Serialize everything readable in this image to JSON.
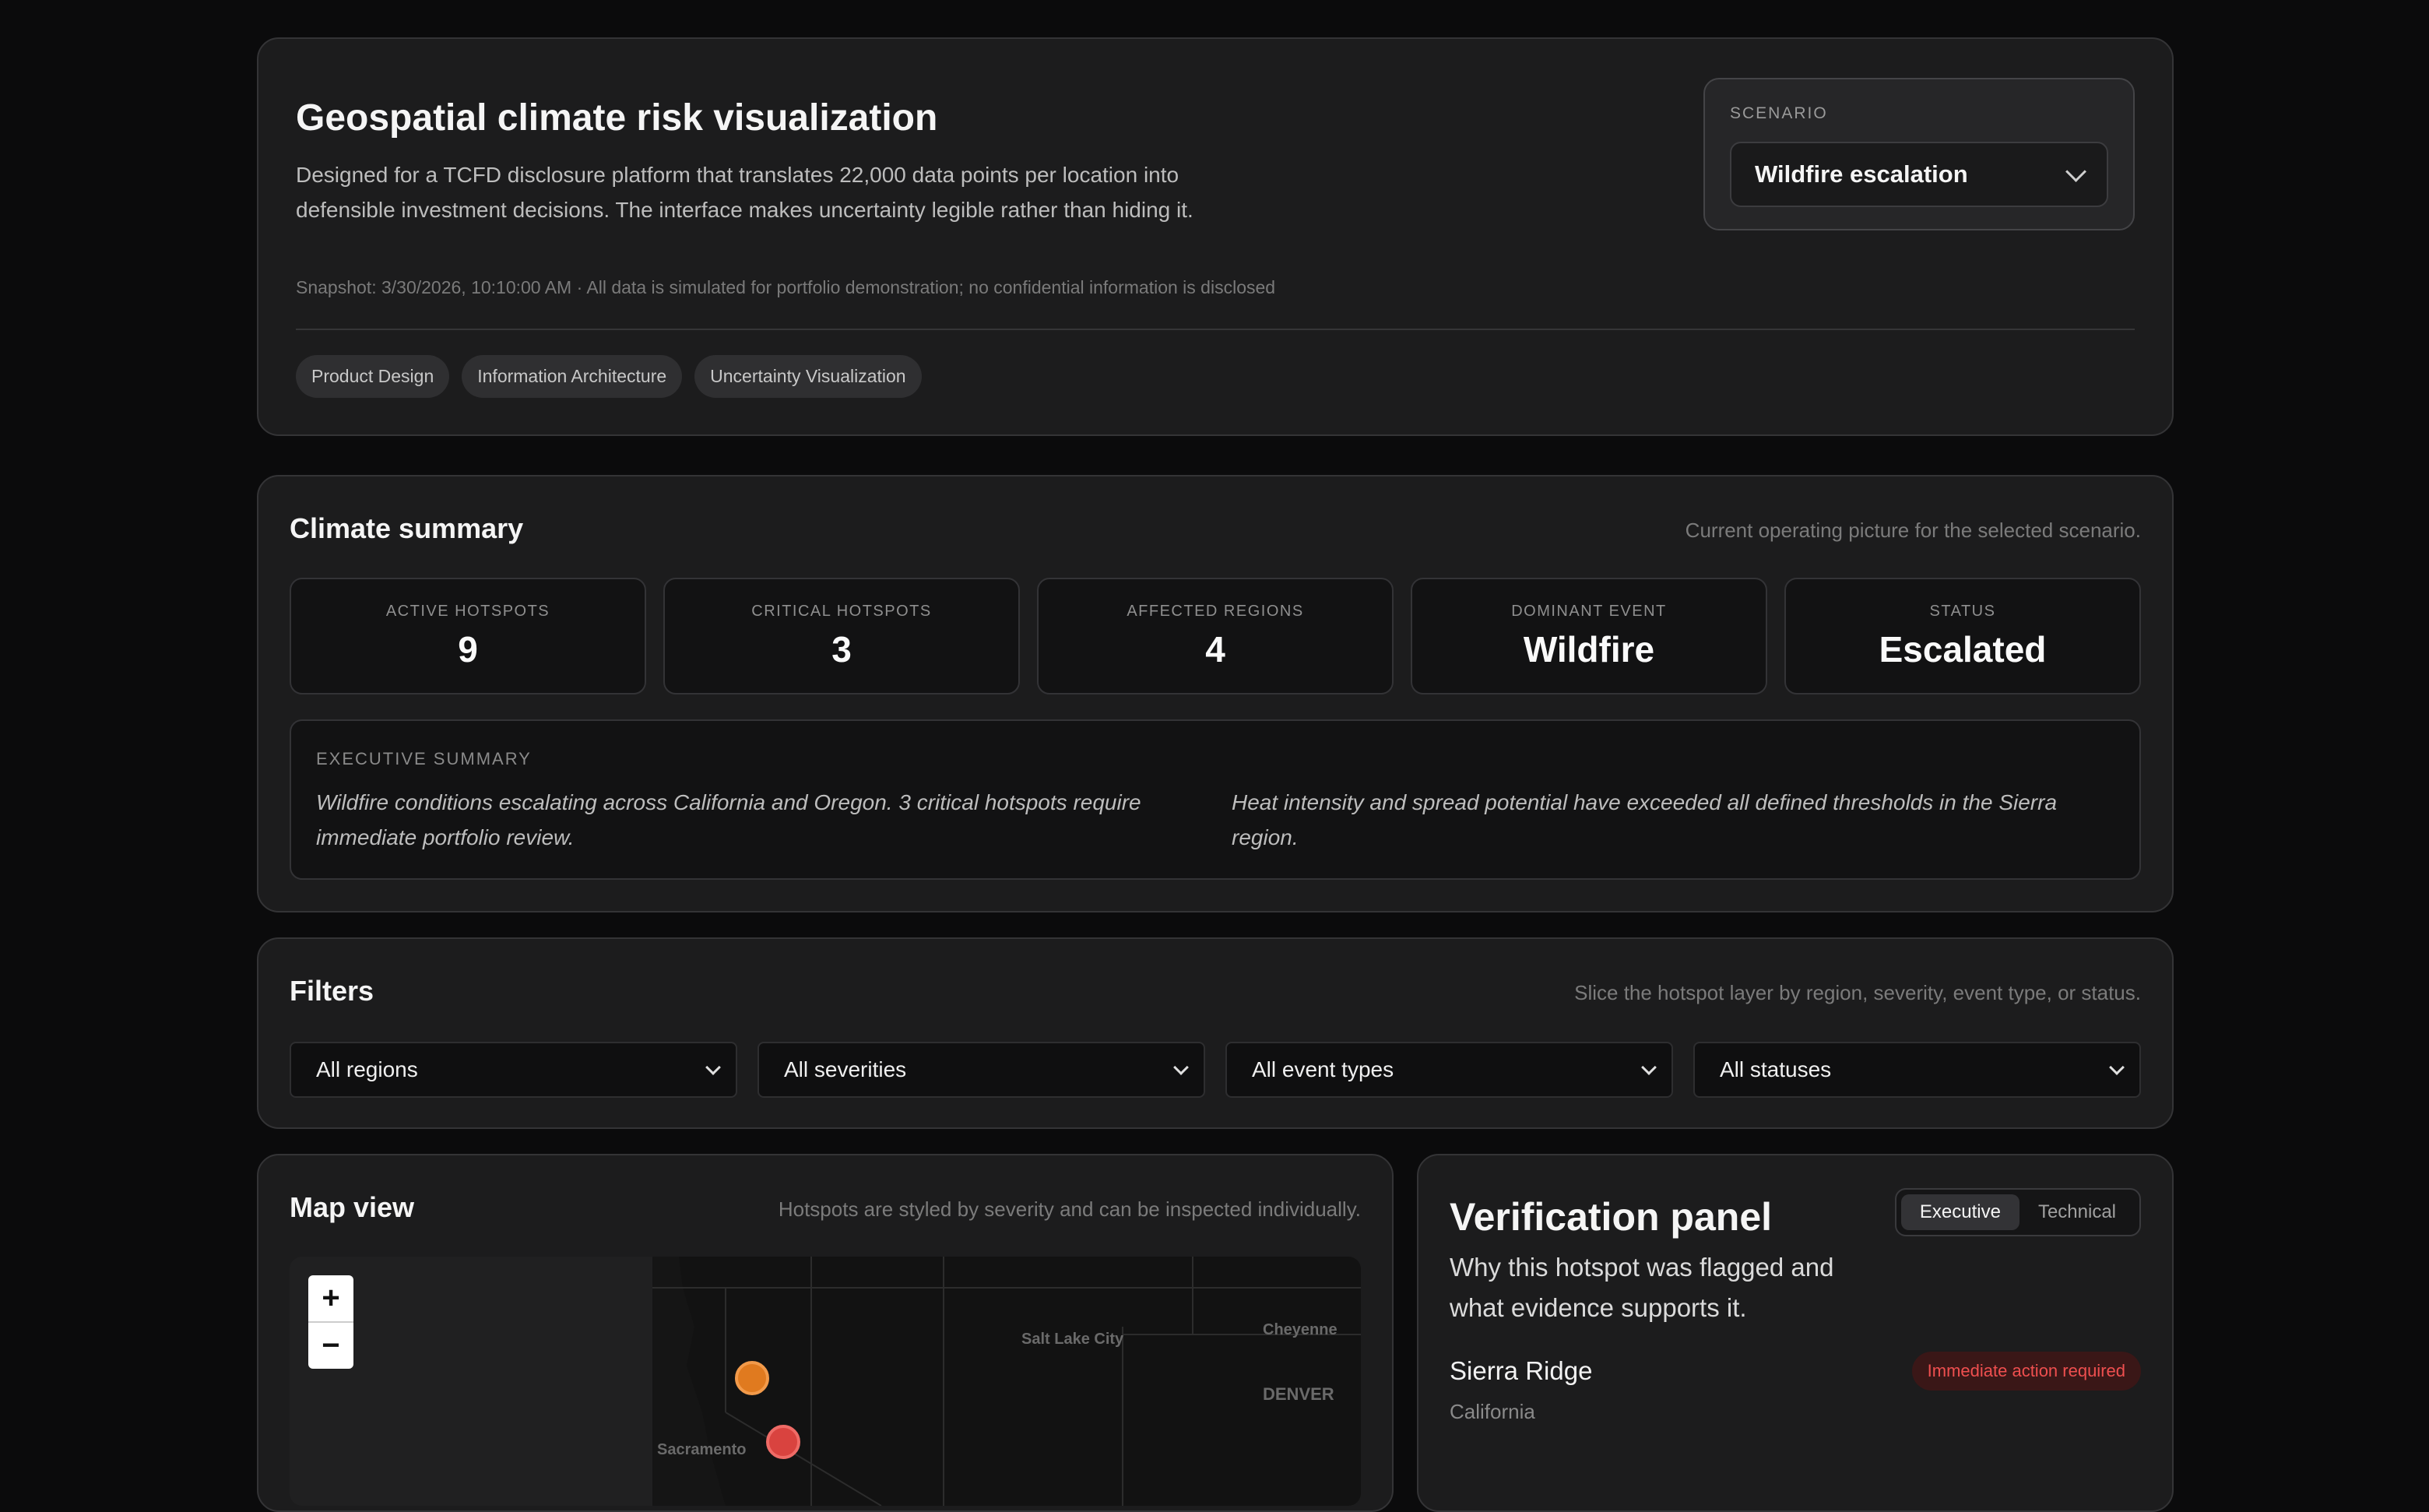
{
  "header": {
    "title": "Geospatial climate risk visualization",
    "description": "Designed for a TCFD disclosure platform that translates 22,000 data points per location into defensible investment decisions. The interface makes uncertainty legible rather than hiding it.",
    "snapshot": "Snapshot: 3/30/2026, 10:10:00 AM · All data is simulated for portfolio demonstration; no confidential information is disclosed",
    "tags": [
      "Product Design",
      "Information Architecture",
      "Uncertainty Visualization"
    ],
    "scenario": {
      "label": "SCENARIO",
      "value": "Wildfire escalation"
    }
  },
  "summary": {
    "title": "Climate summary",
    "subtitle": "Current operating picture for the selected scenario.",
    "metrics": [
      {
        "label": "ACTIVE HOTSPOTS",
        "value": "9"
      },
      {
        "label": "CRITICAL HOTSPOTS",
        "value": "3"
      },
      {
        "label": "AFFECTED REGIONS",
        "value": "4"
      },
      {
        "label": "DOMINANT EVENT",
        "value": "Wildfire"
      },
      {
        "label": "STATUS",
        "value": "Escalated"
      }
    ],
    "executive": {
      "label": "EXECUTIVE SUMMARY",
      "left": "Wildfire conditions escalating across California and Oregon. 3 critical hotspots require immediate portfolio review.",
      "right": "Heat intensity and spread potential have exceeded all defined thresholds in the Sierra region."
    }
  },
  "filters": {
    "title": "Filters",
    "subtitle": "Slice the hotspot layer by region, severity, event type, or status.",
    "selects": [
      "All regions",
      "All severities",
      "All event types",
      "All statuses"
    ]
  },
  "map": {
    "title": "Map view",
    "subtitle": "Hotspots are styled by severity and can be inspected individually.",
    "zoom_in": "+",
    "zoom_out": "−",
    "labels": [
      "Salt Lake City",
      "Cheyenne",
      "DENVER",
      "Sacramento"
    ],
    "hotspot_colors": {
      "high": "#e07a1f",
      "critical": "#d9433f"
    }
  },
  "verification": {
    "title": "Verification panel",
    "description": "Why this hotspot was flagged and what evidence supports it.",
    "tabs": [
      "Executive",
      "Technical"
    ],
    "active_tab": "Executive",
    "location": "Sierra Ridge",
    "region": "California",
    "badge": "Immediate action required"
  }
}
